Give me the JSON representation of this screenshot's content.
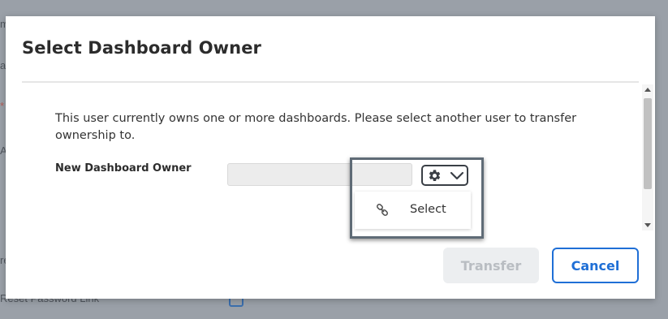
{
  "background": {
    "fragments": [
      "m",
      "ar",
      "*",
      "Ac",
      "re",
      "Reset Password Link"
    ]
  },
  "dialog": {
    "title": "Select Dashboard Owner",
    "message": "This user currently owns one or more dashboards. Please select another user to transfer ownership to.",
    "field_label": "New Dashboard Owner",
    "owner_input": {
      "value": "",
      "placeholder": ""
    },
    "menu": {
      "toggle_icons": [
        "gear-icon",
        "chevron-down-icon"
      ],
      "items": [
        {
          "label": "Select",
          "icon": "link-icon"
        }
      ]
    },
    "buttons": {
      "transfer": "Transfer",
      "cancel": "Cancel"
    }
  },
  "colors": {
    "overlay": "#9aa0a8",
    "cancel_accent": "#1f6fd6",
    "transfer_disabled_bg": "#eceef0",
    "transfer_disabled_text": "#b9bdc2",
    "required_marker": "#c0392b"
  }
}
